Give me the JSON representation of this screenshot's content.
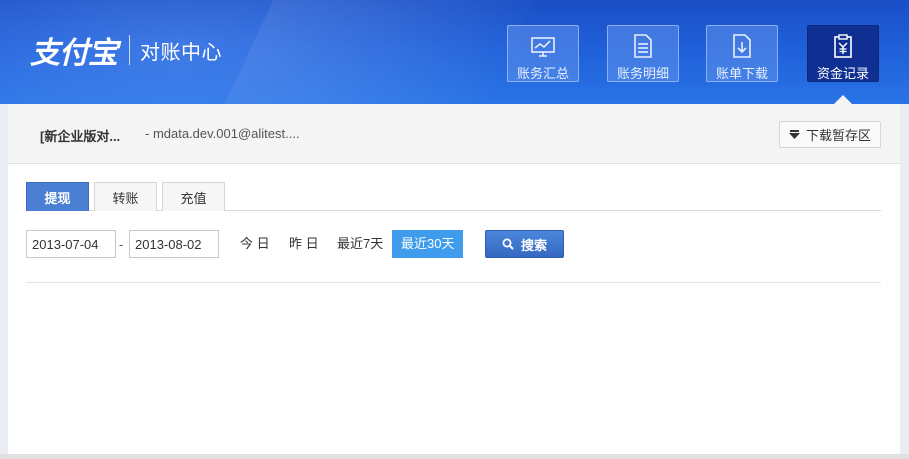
{
  "header": {
    "brand": "支付宝",
    "subtitle": "对账中心",
    "nav": [
      {
        "label": "账务汇总",
        "icon": "chart-monitor-icon",
        "active": false
      },
      {
        "label": "账务明细",
        "icon": "document-icon",
        "active": false
      },
      {
        "label": "账单下载",
        "icon": "download-file-icon",
        "active": false
      },
      {
        "label": "资金记录",
        "icon": "yuan-clipboard-icon",
        "active": true
      }
    ]
  },
  "account": {
    "name": "[新企业版对...",
    "email": "- mdata.dev.001@alitest....",
    "download_area": "下载暂存区"
  },
  "tabs": [
    {
      "label": "提现",
      "active": true
    },
    {
      "label": "转账",
      "active": false
    },
    {
      "label": "充值",
      "active": false
    }
  ],
  "filter": {
    "start_date": "2013-07-04",
    "separator": "-",
    "end_date": "2013-08-02",
    "quick": [
      {
        "label": "今 日",
        "active": false
      },
      {
        "label": "昨 日",
        "active": false
      },
      {
        "label": "最近7天",
        "active": false
      },
      {
        "label": "最近30天",
        "active": true
      }
    ],
    "search_label": "搜索"
  },
  "colors": {
    "header_blue": "#1f5fd8",
    "active_nav": "#0f2f93",
    "active_tab": "#4a7fd4",
    "active_quick": "#3f9ced",
    "search_button": "#3d74cf"
  }
}
